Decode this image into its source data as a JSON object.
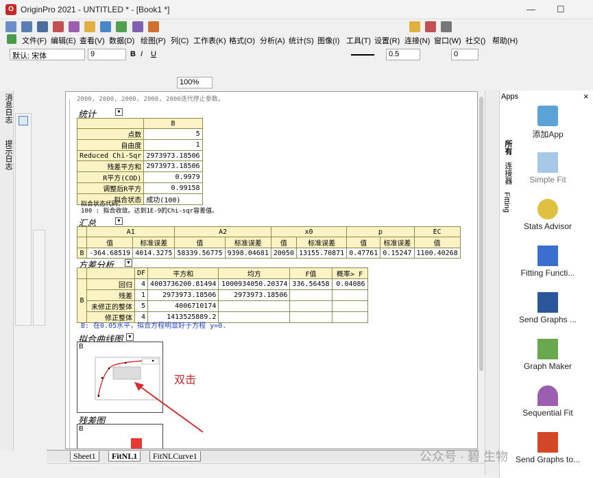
{
  "window": {
    "title": "OriginPro 2021 - UNTITLED * - [Book1 *]",
    "logo": "origin-logo",
    "min": "—",
    "max": "☐"
  },
  "menu": [
    "文件(F)",
    "编辑(E)",
    "查看(V)",
    "数据(D)",
    "绘图(P)",
    "列(C)",
    "工作表(K)",
    "格式(O)",
    "分析(A)",
    "统计(S)",
    "图像(I)",
    "工具(T)",
    "设置(R)",
    "连接(N)",
    "窗口(W)",
    "社交()",
    "帮助(H)"
  ],
  "format": {
    "font": "默认: 宋体",
    "size": "9",
    "linew": "0.5",
    "val0": "0",
    "zoom": "100%"
  },
  "left_panel": {
    "tab1": "消息日志",
    "tab2": "提示日志"
  },
  "report": {
    "top_text": "2000, 2000, 2000, 2000, 2000迭代停止参数。",
    "stats": {
      "title": "统计",
      "col": "B",
      "rows": [
        [
          "点数",
          "5"
        ],
        [
          "自由度",
          "1"
        ],
        [
          "Reduced Chi-Sqr",
          "2973973.18506"
        ],
        [
          "残差平方和",
          "2973973.18506"
        ],
        [
          "R平方(COD)",
          "0.9979"
        ],
        [
          "调整后R平方",
          "0.99158"
        ],
        [
          "拟合状态",
          "成功(100)"
        ]
      ]
    },
    "fit_code_title": "拟合状态代码：",
    "fit_code_text": "100 : 拟合收敛。达到1E-9的Chi-sqr容差值。",
    "summary": {
      "title": "汇总",
      "groups": [
        "A1",
        "A2",
        "x0",
        "p",
        "EC"
      ],
      "subs": [
        "值",
        "标准误差",
        "值",
        "标准误差",
        "值",
        "标准误差",
        "值",
        "标准误差",
        "值"
      ],
      "row_label": "B",
      "values": [
        "-364.68519",
        "4014.3275",
        "58339.56775",
        "9398.04681",
        "20050",
        "13155.70871",
        "0.47761",
        "0.15247",
        "1100.40268"
      ]
    },
    "anova": {
      "title": "方差分析",
      "headers": [
        "DF",
        "平方和",
        "均方",
        "F值",
        "概率> F"
      ],
      "group": "B",
      "rows": [
        [
          "回归",
          "4",
          "4003736200.81494",
          "1000934050.20374",
          "336.56458",
          "0.04086"
        ],
        [
          "残差",
          "1",
          "2973973.18506",
          "2973973.18506",
          "",
          ""
        ],
        [
          "未修正的整体",
          "5",
          "4006710174",
          "",
          "",
          ""
        ],
        [
          "修正整体",
          "4",
          "1413525889.2",
          "",
          "",
          ""
        ]
      ]
    },
    "conclusion": "B: 在0.05水平，拟合方程明显好于方程 y=0.",
    "fitcurve": {
      "title": "拟合曲线图",
      "label": "B",
      "annotation": "双击"
    },
    "residual": {
      "title": "残差图",
      "label": "B"
    }
  },
  "tabs": [
    "Sheet1",
    "FitNL1",
    "FitNLCurve1"
  ],
  "apps": {
    "title": "Apps",
    "close": "×",
    "vtabs": [
      "所有",
      "连接器",
      "Fitting"
    ],
    "items": [
      "添加App",
      "Simple Fit",
      "Stats Advisor",
      "Fitting Functi...",
      "Send Graphs ...",
      "Graph Maker",
      "Sequential Fit",
      "Send Graphs to..."
    ]
  },
  "watermark": "公众号 · 碧  生物",
  "colors": {
    "accent": "#c62828",
    "header": "#fbf3c4",
    "blue": "#1a3fd6"
  }
}
